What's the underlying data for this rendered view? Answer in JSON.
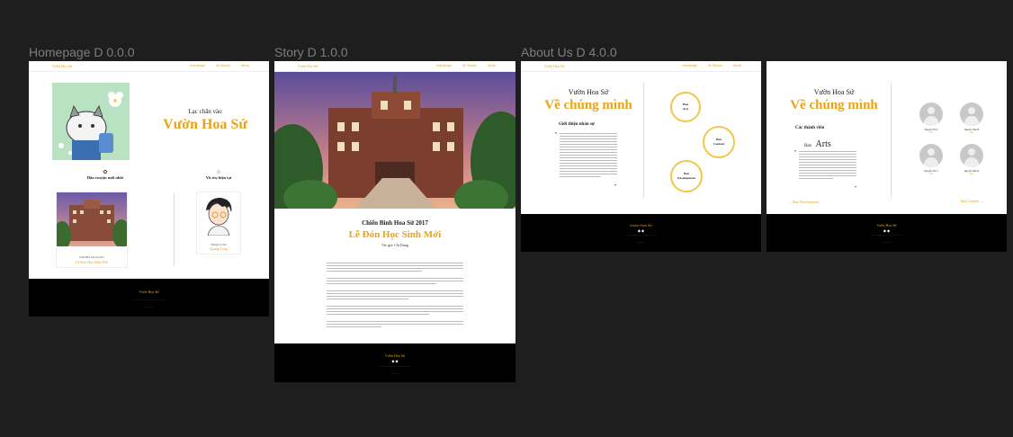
{
  "frames": {
    "homepage": {
      "label": "Homepage D 0.0.0"
    },
    "story": {
      "label": "Story D 1.0.0"
    },
    "about": {
      "label": "About Us D 4.0.0"
    }
  },
  "nav": {
    "brand": "Vườn Hoa Sứ",
    "links": [
      "Homepage",
      "All Stories",
      "About"
    ]
  },
  "homepage": {
    "welcome": "Lạc chân vào",
    "site_title": "Vườn Hoa Sứ",
    "latest_heading": "Đầu truyện mới nhất",
    "universe_heading": "Vũ trụ hiện tại",
    "latest_card_meta": "Chiến Binh Hoa Sứ 2017",
    "latest_card_title": "Lễ Đón Học Sinh Mới",
    "universe_card_meta": "Website Co Nữ",
    "universe_card_title": "Quang Long"
  },
  "story": {
    "series": "Chiến Binh Hoa Sứ 2017",
    "title": "Lễ Đón Học Sinh Mới",
    "author": "Tác giả: Chi Dung"
  },
  "about1": {
    "brand": "Vườn Hoa Sứ",
    "title": "Về chúng mình",
    "intro_heading": "Giới thiệu nhân sự",
    "circles": [
      {
        "top": "Ban",
        "bottom": "Arts"
      },
      {
        "top": "Ban",
        "bottom": "Content"
      },
      {
        "top": "Ban",
        "bottom": "Development"
      }
    ]
  },
  "about2": {
    "brand": "Vườn Hoa Sứ",
    "title": "Về chúng mình",
    "members_heading": "Các thành viên",
    "team_prefix": "Ban",
    "team_name": "Arts",
    "prev_link": "← Ban Development",
    "next_link": "Ban Content →",
    "members": [
      {
        "name": "Nguyễn Thị A",
        "role": "Arts"
      },
      {
        "name": "Nguyễn Văn B",
        "role": "Arts"
      },
      {
        "name": "Nguyễn Thị C",
        "role": "Arts"
      },
      {
        "name": "Nguyễn Văn D",
        "role": "Arts"
      }
    ]
  },
  "footer": {
    "title": "Vườn Hoa Sứ",
    "icons": "◆ ◆"
  },
  "colors": {
    "accent": "#e8a317",
    "canvas": "#1e1e1e",
    "footer": "#000000",
    "circle_border": "#f3c64b"
  },
  "icons": [
    "flower-icon",
    "star-icon",
    "quote-icon",
    "social-icon"
  ]
}
